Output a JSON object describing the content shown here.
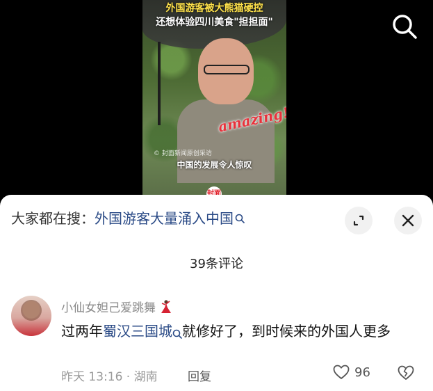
{
  "video": {
    "headline_line1": "外国游客被大熊猫硬控",
    "headline_line2": "还想体验四川美食\"担担面\"",
    "sticker": "amazing!",
    "watermark": "© 封面新闻原创采访",
    "caption": "中国的发展令人惊叹",
    "badge": "封面"
  },
  "header": {
    "search_icon": "search-icon"
  },
  "sheet": {
    "trending_prefix": "大家都在搜：",
    "trending_link": "外国游客大量涌入中国",
    "expand_icon": "expand-icon",
    "close_icon": "close-icon",
    "comment_count": "39条评论"
  },
  "comments": [
    {
      "username": "小仙女妲己爱跳舞",
      "text_before": "过两年",
      "text_link": "蜀汉三国城",
      "text_after": "就修好了，到时候来的外国人更多",
      "time_location": "昨天 13:16 · 湖南",
      "reply_label": "回复",
      "likes": "96"
    }
  ],
  "colors": {
    "link": "#2a4a86",
    "sheet_bg": "#ffffff",
    "video_bg": "#000000"
  }
}
